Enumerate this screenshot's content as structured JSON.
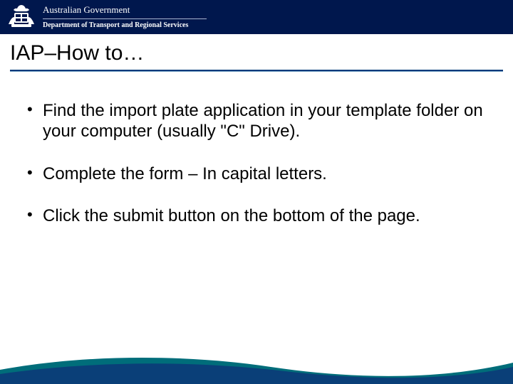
{
  "header": {
    "gov_title": "Australian Government",
    "dept_title": "Department of Transport and Regional Services"
  },
  "title": "IAP–How to…",
  "bullets": [
    "Find the import plate application in your template folder on your computer (usually \"C\" Drive).",
    "Complete the form – In capital letters.",
    "Click the submit button on the bottom of the page."
  ],
  "colors": {
    "header_bg": "#00174d",
    "rule": "#003a7a",
    "wave1": "#006d7a",
    "wave2": "#0a3f78"
  }
}
